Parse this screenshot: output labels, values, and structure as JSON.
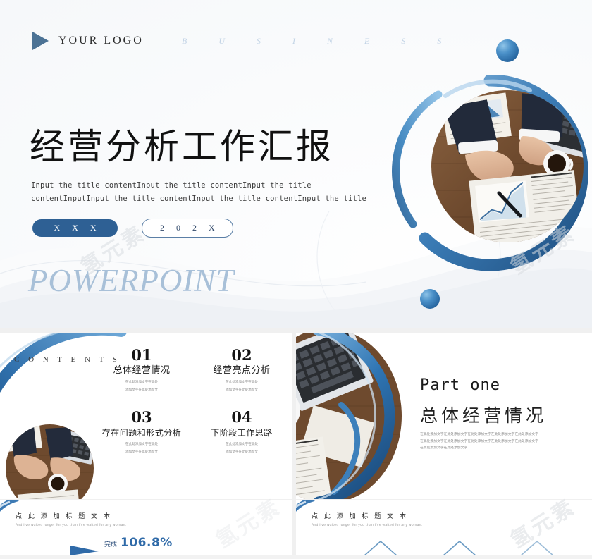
{
  "document": {
    "type": "powerpoint-template-preview",
    "watermark": "氢元素",
    "accent_color": "#2e6094",
    "accent_light": "#4a90c8",
    "muted_color": "#a8c0d8"
  },
  "slide1": {
    "logo_text": "YOUR LOGO",
    "logo_icon": "play-triangle-icon",
    "business_word": "B U S I N E S S",
    "title": "经营分析工作汇报",
    "subtitle": "Input the title contentInput the title contentInput the title contentInputInput the title contentInput the title contentInput the title",
    "badge_primary": "X X X",
    "badge_secondary": "2 0 2 X",
    "footer_word": "POWERPOINT",
    "hero_image_alt": "businessmen hands reviewing charts on wooden desk with coffee and laptop"
  },
  "slide2": {
    "section_label": "C O N T E N T S",
    "photo_alt": "hands on desk with laptop coffee and documents",
    "items": [
      {
        "number": "01",
        "title": "总体经营情况",
        "desc_line1": "在此处添加文字在此处",
        "desc_line2": "添加文字在此处添加文"
      },
      {
        "number": "02",
        "title": "经营亮点分析",
        "desc_line1": "在此处添加文字在此处",
        "desc_line2": "添加文字在此处添加文"
      },
      {
        "number": "03",
        "title": "存在问题和形式分析",
        "desc_line1": "在此处添加文字在此处",
        "desc_line2": "添加文字在此处添加文"
      },
      {
        "number": "04",
        "title": "下阶段工作思路",
        "desc_line1": "在此处添加文字在此处",
        "desc_line2": "添加文字在此处添加文"
      }
    ]
  },
  "slide3": {
    "part_label": "Part one",
    "title": "总体经营情况",
    "body": "在此处添加文字在此处添加文字在此处添加文字在此处添加文字在此处添加文字在此处添加文字在此处添加文字在此处添加文字在此处添加文字在此处添加文字在此处添加文字在此处添加文字",
    "photo_alt": "laptop coffee newspaper on wooden desk"
  },
  "slide4": {
    "heading": "点 此 添 加 标 题 文 本",
    "subheading": "And I've waited longer for you than I've waited for any woman.",
    "kpi_label": "完成",
    "kpi_value": "106.8%"
  },
  "slide5": {
    "heading": "点 此 添 加 标 题 文 本",
    "subheading": "And I've waited longer for you than I've waited for any woman.",
    "shapes": [
      "chevron-icon",
      "chevron-icon",
      "chevron-icon"
    ]
  }
}
